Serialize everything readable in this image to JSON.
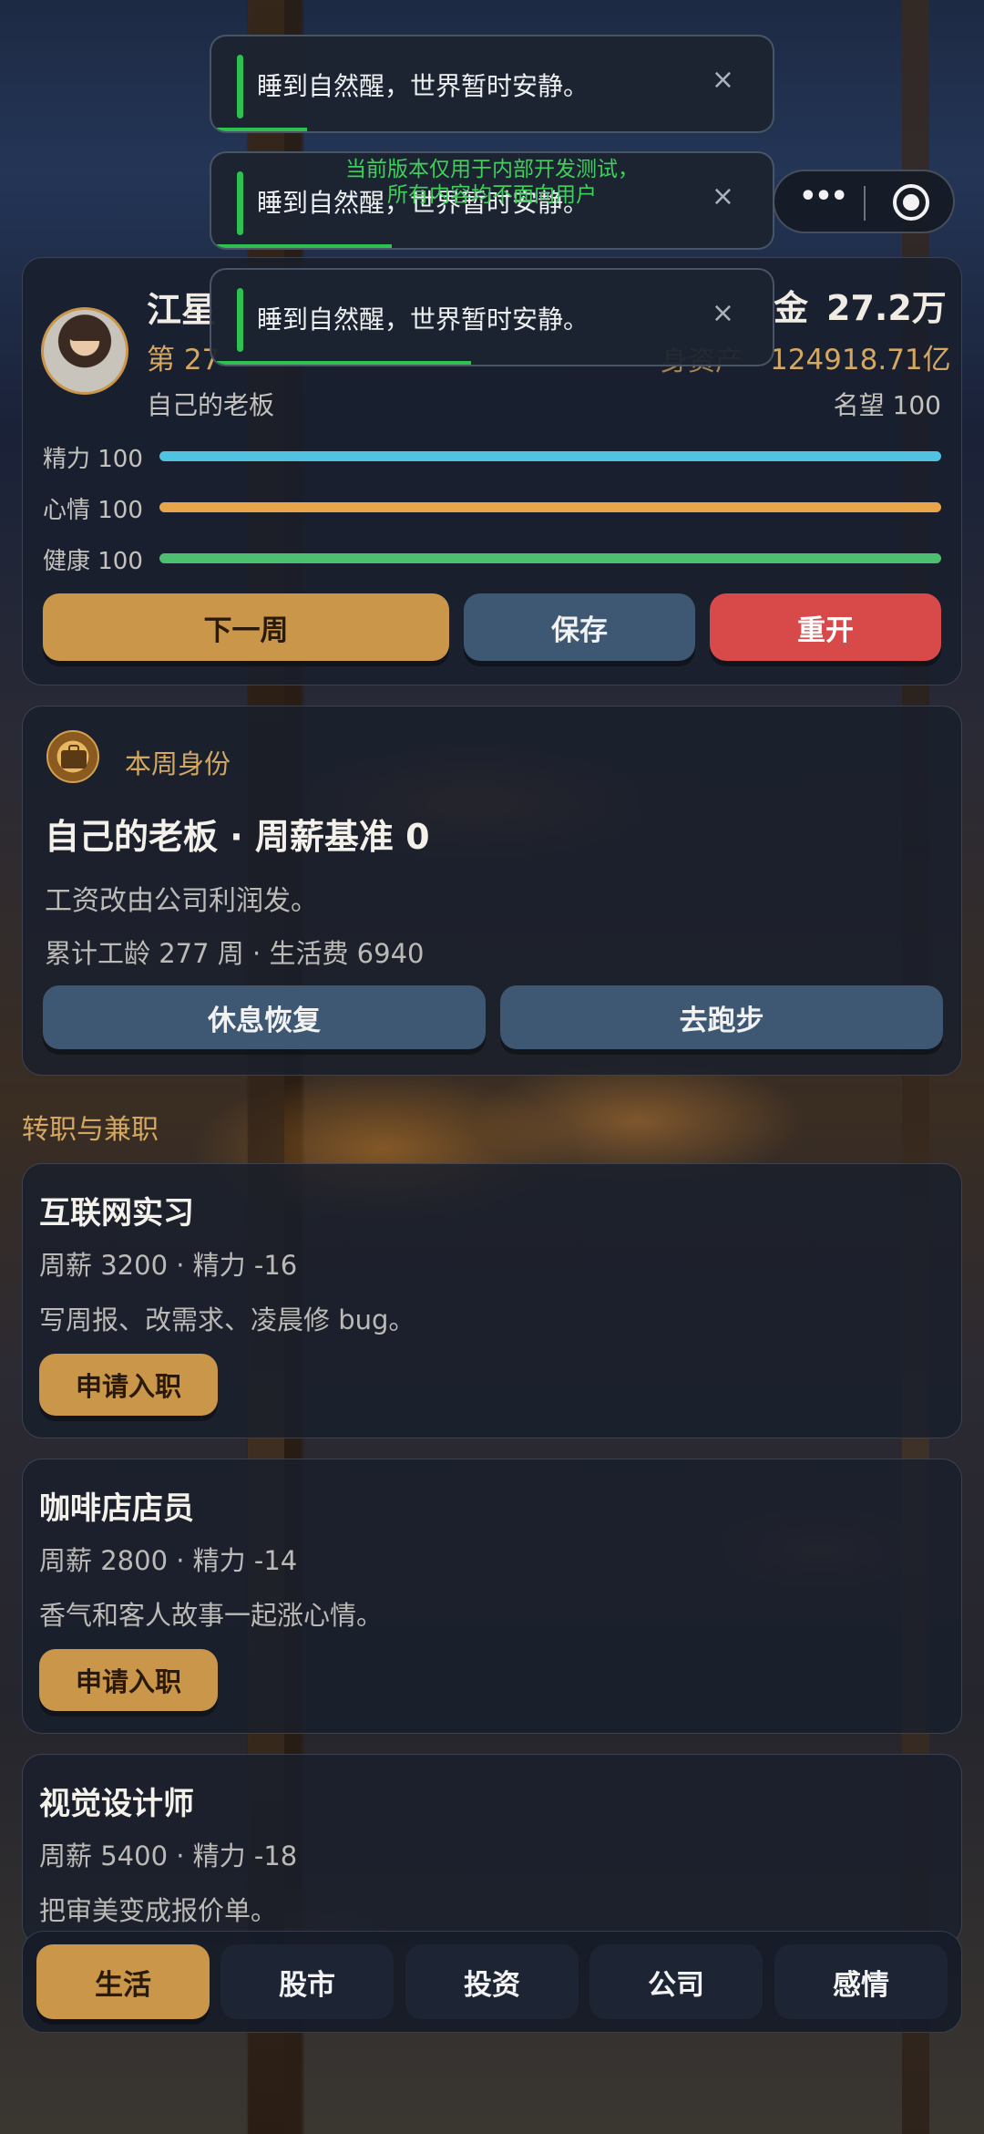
{
  "toasts": [
    {
      "message": "睡到自然醒，世界暂时安静。",
      "close": "×",
      "progress": 0.17
    },
    {
      "message": "睡到自然醒，世界暂时安静。",
      "close": "×",
      "progress": 0.32
    },
    {
      "message": "睡到自然醒，世界暂时安静。",
      "close": "×",
      "progress": 0.46
    }
  ],
  "dev_notice": {
    "line1": "当前版本仅用于内部开发测试，",
    "line2": "所有内容均不面向用户"
  },
  "capsule": {
    "menu_icon": "•••",
    "close_icon": "◉"
  },
  "player": {
    "name": "江星",
    "week": "第 27",
    "status": "自己的老板",
    "cash_label": "金",
    "cash": "27.2万",
    "net_worth_label": "身资产",
    "net_worth": "124918.71亿",
    "fame": "名望 100",
    "energy_label": "精力 100",
    "energy": 100,
    "mood_label": "心情 100",
    "mood": 100,
    "health_label": "健康 100",
    "health": 100
  },
  "actions": {
    "next_week": "下一周",
    "save": "保存",
    "restart": "重开"
  },
  "identity": {
    "header": "本周身份",
    "title": "自己的老板 · 周薪基准 0",
    "desc": "工资改由公司利润发。",
    "meta": "累计工龄 277 周 · 生活费 6940",
    "rest": "休息恢复",
    "run": "去跑步"
  },
  "jobs_section_title": "转职与兼职",
  "jobs": [
    {
      "title": "互联网实习",
      "meta": "周薪 3200 · 精力 -16",
      "desc": "写周报、改需求、凌晨修 bug。",
      "apply": "申请入职"
    },
    {
      "title": "咖啡店店员",
      "meta": "周薪 2800 · 精力 -14",
      "desc": "香气和客人故事一起涨心情。",
      "apply": "申请入职"
    },
    {
      "title": "视觉设计师",
      "meta": "周薪 5400 · 精力 -18",
      "desc": "把审美变成报价单。"
    }
  ],
  "tabs": [
    "生活",
    "股市",
    "投资",
    "公司",
    "感情"
  ],
  "colors": {
    "gold": "#c9964a",
    "steel": "#3e5874",
    "red": "#d84a4a",
    "energy": "#4fc3e0",
    "mood": "#e8a54a",
    "health": "#4cc070",
    "toast_accent": "#2ec050"
  }
}
